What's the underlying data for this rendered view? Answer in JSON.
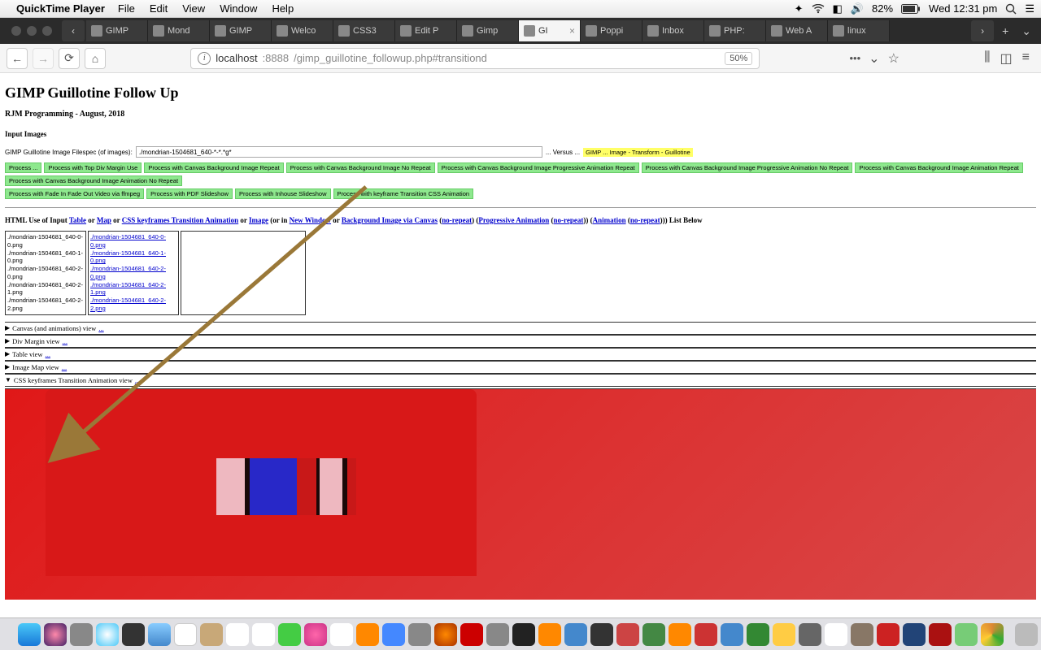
{
  "menubar": {
    "appname": "QuickTime Player",
    "items": [
      "File",
      "Edit",
      "View",
      "Window",
      "Help"
    ],
    "battery_pct": "82%",
    "clock": "Wed 12:31 pm"
  },
  "tabs": {
    "list": [
      {
        "label": "GIMP"
      },
      {
        "label": "Mond"
      },
      {
        "label": "GIMP"
      },
      {
        "label": "Welco"
      },
      {
        "label": "CSS3"
      },
      {
        "label": "Edit P"
      },
      {
        "label": "Gimp"
      },
      {
        "label": "GI",
        "active": true
      },
      {
        "label": "Poppi"
      },
      {
        "label": "Inbox"
      },
      {
        "label": "PHP:"
      },
      {
        "label": "Web A"
      },
      {
        "label": "linux"
      }
    ]
  },
  "url": {
    "host": "localhost",
    "port": ":8888",
    "path": "/gimp_guillotine_followup.php#transitiond",
    "zoom": "50%"
  },
  "page": {
    "h1": "GIMP Guillotine Follow Up",
    "byline": "RJM Programming - August, 2018",
    "section_input": "Input Images",
    "filespec_label": "GIMP Guillotine Image Filespec (of images):",
    "filespec_value": "./mondrian-1504681_640-*-*.*g*",
    "versus_text": "... Versus ...",
    "gimp_badge": "GIMP ... Image - Transform - Guillotine",
    "buttons_row1": [
      "Process ...",
      "Process with Top Div Margin Use",
      "Process with Canvas Background Image Repeat",
      "Process with Canvas Background Image No Repeat",
      "Process with Canvas Background Image Progressive Animation Repeat",
      "Process with Canvas Background Image Progressive Animation No Repeat",
      "Process with Canvas Background Image Animation Repeat",
      "Process with Canvas Background Image Animation No Repeat"
    ],
    "buttons_row2": [
      "Process with Fade In Fade Out Video via ffmpeg",
      "Process with PDF Slideshow",
      "Process with Inhouse Slideshow",
      "Process with keyframe Transition CSS Animation"
    ],
    "html_use_prefix": "HTML Use of Input ",
    "html_use_parts": {
      "table": "Table",
      "or1": " or ",
      "map": "Map",
      "or2": " or ",
      "css": "CSS keyframes Transition Animation",
      "or3": " or ",
      "image": "Image",
      "orin": " (or in ",
      "newwin": "New Window",
      "or4": " or ",
      "bgimg": "Background Image via Canvas",
      "p1": " (",
      "norepeat1": "no-repeat",
      "p2": ") (",
      "prog": "Progressive Animation",
      "p3": " (",
      "norepeat2": "no-repeat",
      "p4": ")) (",
      "anim": "Animation",
      "p5": " (",
      "norepeat3": "no-repeat",
      "p6": "))) List Below"
    },
    "col1": [
      "./mondrian-1504681_640-0-0.png",
      "./mondrian-1504681_640-1-0.png",
      "./mondrian-1504681_640-2-0.png",
      "./mondrian-1504681_640-2-1.png",
      "./mondrian-1504681_640-2-2.png"
    ],
    "col2": [
      "./mondrian-1504681_640-0-0.png",
      "./mondrian-1504681_640-1-0.png",
      "./mondrian-1504681_640-2-0.png",
      "./mondrian-1504681_640-2-1.png",
      "./mondrian-1504681_640-2-2.png"
    ],
    "details": [
      {
        "open": false,
        "label": "Canvas (and animations) view "
      },
      {
        "open": false,
        "label": "Div Margin view "
      },
      {
        "open": false,
        "label": "Table view "
      },
      {
        "open": false,
        "label": "Image Map view "
      },
      {
        "open": true,
        "label": "CSS keyframes Transition Animation view "
      }
    ],
    "dots": "..."
  }
}
